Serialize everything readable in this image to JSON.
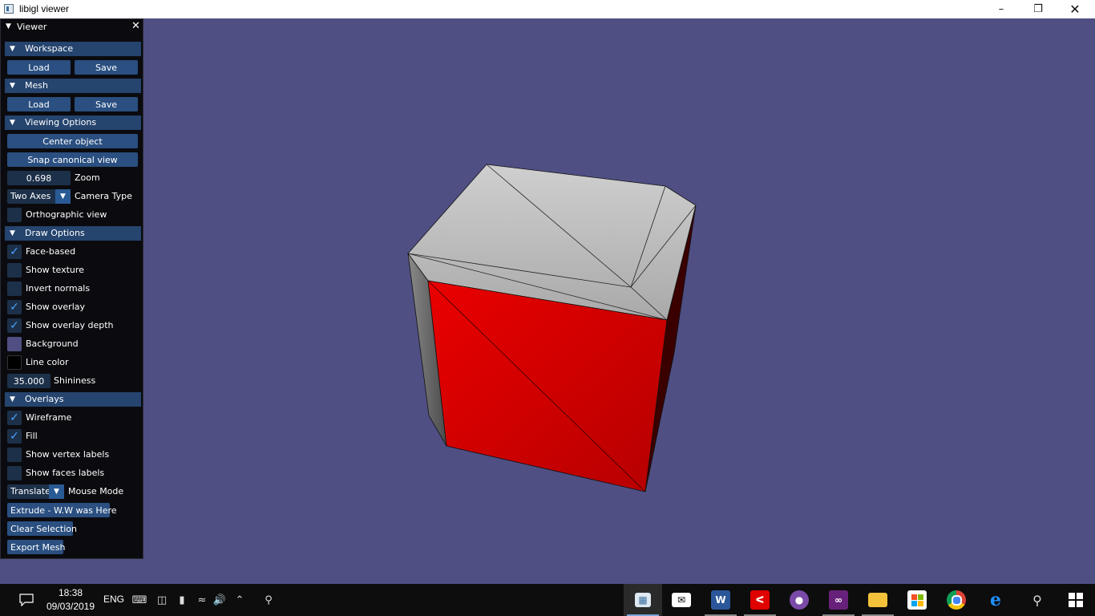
{
  "window": {
    "title": "libigl viewer"
  },
  "panel": {
    "title": "Viewer",
    "workspace": {
      "header": "Workspace",
      "load": "Load",
      "save": "Save"
    },
    "mesh": {
      "header": "Mesh",
      "load": "Load",
      "save": "Save"
    },
    "viewing": {
      "header": "Viewing Options",
      "center_object": "Center object",
      "snap_canonical": "Snap canonical view",
      "zoom_value": "0.698",
      "zoom_label": "Zoom",
      "camera_type_value": "Two Axes",
      "camera_type_label": "Camera Type",
      "orthographic": {
        "label": "Orthographic view",
        "checked": false
      }
    },
    "draw": {
      "header": "Draw Options",
      "face_based": {
        "label": "Face-based",
        "checked": true
      },
      "show_texture": {
        "label": "Show texture",
        "checked": false
      },
      "invert_normals": {
        "label": "Invert normals",
        "checked": false
      },
      "show_overlay": {
        "label": "Show overlay",
        "checked": true
      },
      "show_overlay_depth": {
        "label": "Show overlay depth",
        "checked": true
      },
      "background": {
        "label": "Background",
        "color": "#4f4f83"
      },
      "line_color": {
        "label": "Line color",
        "color": "#000000"
      },
      "shininess_value": "35.000",
      "shininess_label": "Shininess"
    },
    "overlays": {
      "header": "Overlays",
      "wireframe": {
        "label": "Wireframe",
        "checked": true
      },
      "fill": {
        "label": "Fill",
        "checked": true
      },
      "vertex_labels": {
        "label": "Show vertex labels",
        "checked": false
      },
      "faces_labels": {
        "label": "Show faces labels",
        "checked": false
      }
    },
    "mouse_mode_value": "Translate",
    "mouse_mode_label": "Mouse Mode",
    "extrude_button": "Extrude - W.W was Here",
    "clear_selection_button": "Clear Selection",
    "export_mesh_button": "Export Mesh"
  },
  "taskbar": {
    "time": "18:38",
    "date": "09/03/2019",
    "language": "ENG",
    "apps": [
      "libigl-viewer-icon",
      "mail-icon",
      "word-icon",
      "acrobat-icon",
      "github-desktop-icon",
      "visual-studio-icon",
      "file-explorer-icon",
      "store-icon",
      "chrome-icon",
      "edge-icon"
    ]
  },
  "colors": {
    "viewport_bg": "#4f4f83",
    "panel_bg": "#0b0b0f",
    "header_bg": "#25446e",
    "button_bg": "#2a4f80",
    "checkmark": "#4aa3ff",
    "mesh_selected_face": "#d40000",
    "mesh_face": "#b9b9b9"
  }
}
